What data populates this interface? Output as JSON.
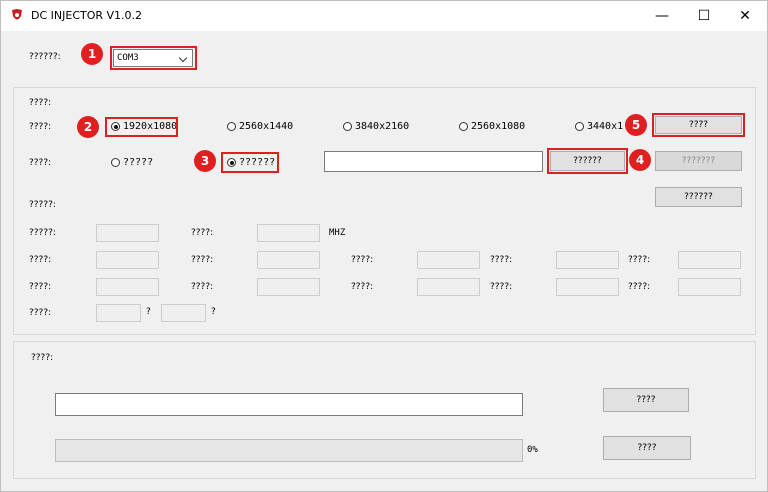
{
  "window": {
    "title": "DC INJECTOR V1.0.2",
    "minimize_glyph": "—",
    "maximize_glyph": "☐",
    "close_glyph": "✕"
  },
  "port": {
    "label": "??????:",
    "selected": "COM3"
  },
  "resolution": {
    "header_label": "????:",
    "row_label": "????:",
    "options": [
      "1920x1080",
      "2560x1440",
      "3840x2160",
      "2560x1080",
      "3440x1"
    ],
    "selected_index": 0,
    "button_label": "????"
  },
  "mode": {
    "row_label": "????:",
    "option_a": "?????",
    "option_b": "??????",
    "selected": "option_b",
    "path_value": "",
    "browse_label": "??????",
    "disabled_label": "???????",
    "extra_button_label": "??????"
  },
  "info": {
    "header_label": "?????:",
    "freq_label_1": "?????:",
    "freq_label_2": "????:",
    "freq_unit": "MHZ",
    "row2_labels": [
      "????:",
      "????:",
      "????:",
      "????:",
      "????:"
    ],
    "row3_labels": [
      "????:",
      "????:",
      "????:",
      "????:",
      "????:"
    ],
    "last_label": "????:",
    "q1": "?",
    "q2": "?"
  },
  "log": {
    "label": "????:",
    "button1_label": "????",
    "button2_label": "????",
    "progress_percent": 0,
    "progress_text": "0%"
  },
  "annotations": [
    "1",
    "2",
    "3",
    "4",
    "5"
  ],
  "colors": {
    "annotation_red": "#e02020",
    "window_bg": "#f0f0f0"
  }
}
